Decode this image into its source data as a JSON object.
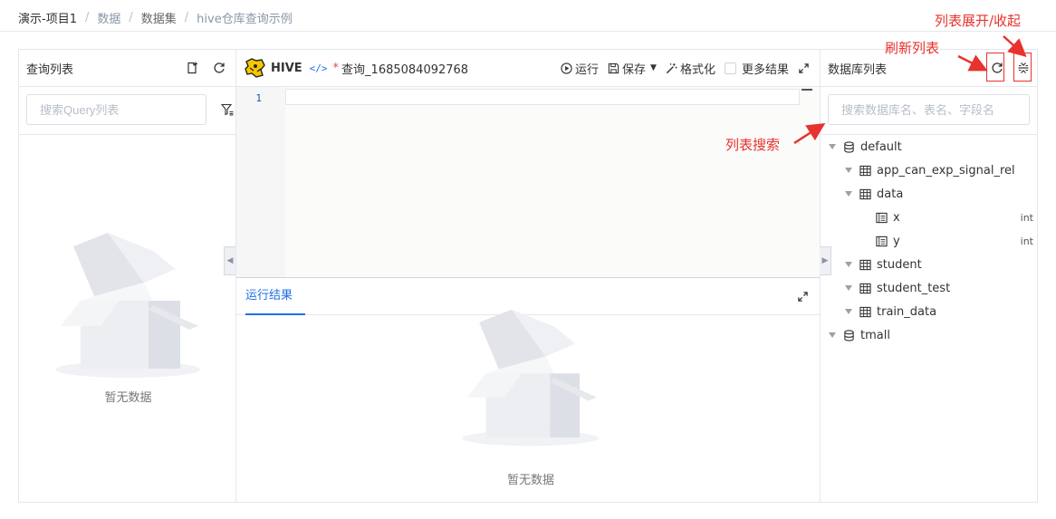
{
  "breadcrumb": [
    "演示-项目1",
    "数据",
    "数据集",
    "hive仓库查询示例"
  ],
  "left_panel": {
    "title": "查询列表",
    "search_placeholder": "搜索Query列表",
    "empty_text": "暂无数据"
  },
  "editor": {
    "engine": "HIVE",
    "code_tag": "</>",
    "unsaved_mark": "*",
    "query_name": "查询_1685084092768",
    "run_label": "运行",
    "save_label": "保存",
    "format_label": "格式化",
    "more_results_label": "更多结果",
    "line_numbers": [
      "1"
    ]
  },
  "results": {
    "tab_label": "运行结果",
    "empty_text": "暂无数据"
  },
  "right_panel": {
    "title": "数据库列表",
    "search_placeholder": "搜索数据库名、表名、字段名",
    "tree": [
      {
        "label": "default",
        "kind": "database"
      },
      {
        "label": "app_can_exp_signal_rel",
        "kind": "table"
      },
      {
        "label": "data",
        "kind": "table"
      },
      {
        "label": "x",
        "kind": "field",
        "type": "int"
      },
      {
        "label": "y",
        "kind": "field",
        "type": "int"
      },
      {
        "label": "student",
        "kind": "table"
      },
      {
        "label": "student_test",
        "kind": "table"
      },
      {
        "label": "train_data",
        "kind": "table"
      },
      {
        "label": "tmall",
        "kind": "database"
      }
    ]
  },
  "annotations": {
    "toggle": "列表展开/收起",
    "refresh": "刷新列表",
    "search": "列表搜索"
  },
  "colors": {
    "accent": "#1f6fe6",
    "annotation_red": "#e8322e"
  }
}
